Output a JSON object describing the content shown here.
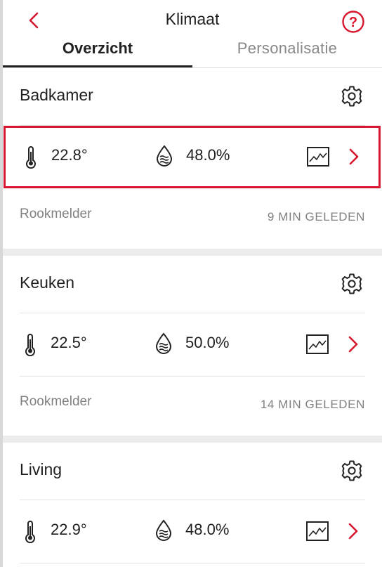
{
  "header": {
    "title": "Klimaat",
    "tabs": [
      {
        "label": "Overzicht",
        "active": true
      },
      {
        "label": "Personalisatie",
        "active": false
      }
    ],
    "back_icon": "chevron-left-icon",
    "help_icon": "question-circle-icon"
  },
  "colors": {
    "accent": "#d7172f",
    "muted_text": "#808080",
    "section_gap": "#ececec"
  },
  "rooms": [
    {
      "name": "Badkamer",
      "temperature": "22.8°",
      "humidity": "48.0%",
      "sensor": "Rookmelder",
      "last_update": "9 MIN GELEDEN",
      "selected": true
    },
    {
      "name": "Keuken",
      "temperature": "22.5°",
      "humidity": "50.0%",
      "sensor": "Rookmelder",
      "last_update": "14 MIN GELEDEN",
      "selected": false
    },
    {
      "name": "Living",
      "temperature": "22.9°",
      "humidity": "48.0%",
      "selected": false
    }
  ]
}
